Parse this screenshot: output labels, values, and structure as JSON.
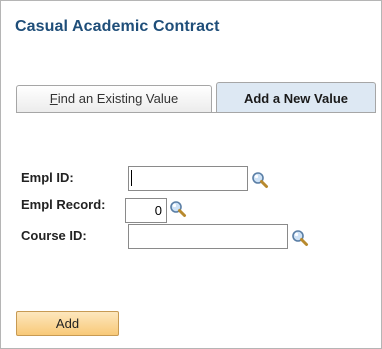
{
  "page": {
    "title": "Casual Academic Contract"
  },
  "tabs": [
    {
      "label_mnemonic": "F",
      "label_rest": "ind an Existing Value"
    },
    {
      "label": "Add a New Value"
    }
  ],
  "form": {
    "empl_id": {
      "label": "Empl ID:",
      "value": ""
    },
    "empl_record": {
      "label": "Empl Record:",
      "value": "0"
    },
    "course_id": {
      "label": "Course ID:",
      "value": ""
    }
  },
  "actions": {
    "add_label": "Add"
  },
  "colors": {
    "title": "#1f4e79",
    "active_tab_bg": "#dde8f3",
    "button_top": "#fde7bd",
    "button_bottom": "#f8c978",
    "button_border": "#c79a53"
  },
  "icons": {
    "lookup": "magnifying-glass-icon"
  }
}
